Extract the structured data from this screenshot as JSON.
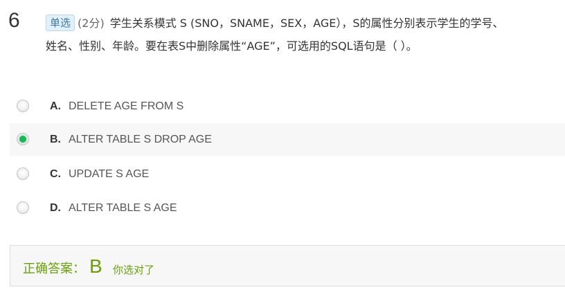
{
  "question": {
    "number": "6",
    "type_badge": "单选",
    "score": "(2分)",
    "text_line1": "学生关系模式 S (SNO，SNAME，SEX，AGE），S的属性分别表示学生的学号、",
    "text_line2": "姓名、性别、年龄。要在表S中删除属性“AGE”，可选用的SQL语句是（   ）。"
  },
  "options": [
    {
      "letter": "A.",
      "text": "DELETE AGE FROM S",
      "selected": false
    },
    {
      "letter": "B.",
      "text": "ALTER TABLE S DROP AGE",
      "selected": true
    },
    {
      "letter": "C.",
      "text": "UPDATE S AGE",
      "selected": false
    },
    {
      "letter": "D.",
      "text": "ALTER TABLE S AGE",
      "selected": false
    }
  ],
  "answer": {
    "label": "正确答案：",
    "value": "B",
    "note": "你选对了"
  },
  "colors": {
    "accent_green": "#6aa00c",
    "radio_selected": "#1fb35a",
    "badge_bg": "#e3f0f9"
  }
}
